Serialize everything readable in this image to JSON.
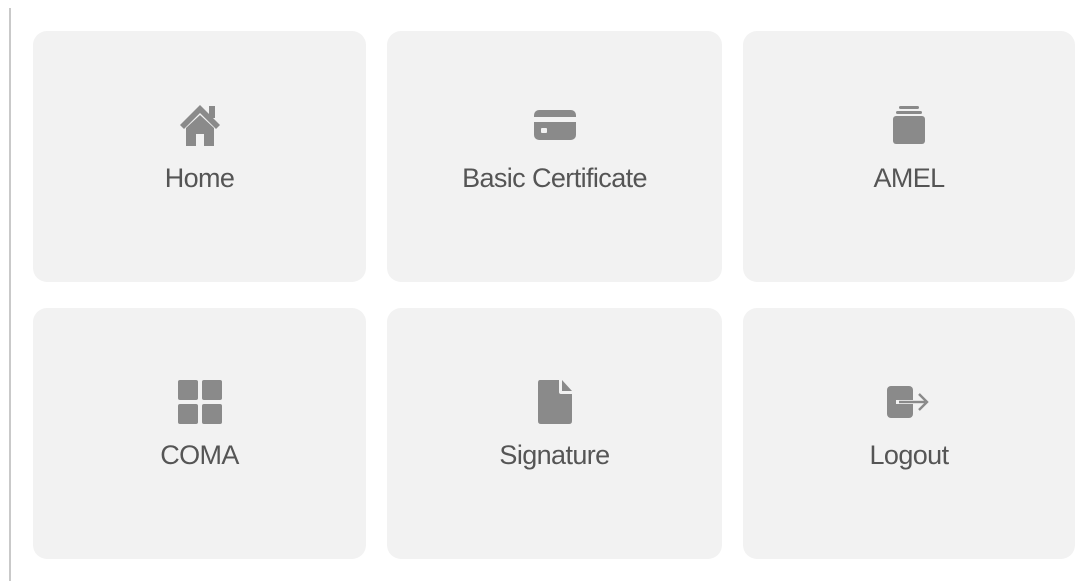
{
  "tiles": [
    {
      "label": "Home",
      "icon": "home-icon"
    },
    {
      "label": "Basic Certificate",
      "icon": "credit-card-icon"
    },
    {
      "label": "AMEL",
      "icon": "stack-icon"
    },
    {
      "label": "COMA",
      "icon": "grid-icon"
    },
    {
      "label": "Signature",
      "icon": "file-icon"
    },
    {
      "label": "Logout",
      "icon": "logout-icon"
    }
  ],
  "colors": {
    "tile_background": "#f2f2f2",
    "icon": "#8a8a8a",
    "label": "#555555",
    "divider": "#c9c9c9"
  }
}
